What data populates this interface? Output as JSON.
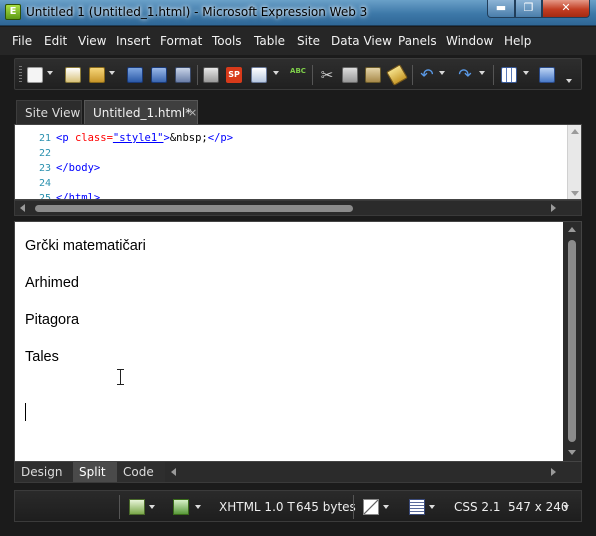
{
  "window": {
    "title": "Untitled 1 (Untitled_1.html) - Microsoft Expression Web 3",
    "app_icon_letter": "E",
    "min_glyph": "▬",
    "max_glyph": "❐",
    "close_glyph": "✕"
  },
  "menu": [
    "File",
    "Edit",
    "View",
    "Insert",
    "Format",
    "Tools",
    "Table",
    "Site",
    "Data View",
    "Panels",
    "Window",
    "Help"
  ],
  "toolbar": {
    "icons": [
      "new-page-icon",
      "open-icon",
      "open-folder-icon",
      "save-icon",
      "save-all-icon",
      "find-icon",
      "print-icon",
      "sharepoint-icon",
      "preview-in-browser-icon",
      "spelling-icon",
      "cut-icon",
      "copy-icon",
      "paste-icon",
      "format-painter-icon",
      "undo-icon",
      "redo-icon",
      "insert-table-icon",
      "insert-layer-icon"
    ],
    "sharepoint_label": "SP",
    "spelling_label": "ABC"
  },
  "tabs": {
    "site_view": "Site View",
    "document": "Untitled_1.html*",
    "close_glyph": "×"
  },
  "code": {
    "lines": [
      {
        "num": "21",
        "tag_open": "<p ",
        "attr": "class=",
        "value": "\"style1\"",
        "rest": ">",
        "entity": "&nbsp;",
        "tag_close": "</p>"
      },
      {
        "num": "22",
        "text": ""
      },
      {
        "num": "23",
        "text": "</body>"
      },
      {
        "num": "24",
        "text": ""
      },
      {
        "num": "25",
        "text": "</html>"
      }
    ]
  },
  "design": {
    "paragraphs": [
      "Grčki matematičari",
      "Arhimed",
      "Pitagora",
      "Tales"
    ]
  },
  "views": {
    "design": "Design",
    "split": "Split",
    "code": "Code",
    "active": "Split"
  },
  "status": {
    "doctype": "XHTML 1.0 T",
    "size": "645 bytes",
    "css": "CSS 2.1",
    "dimensions": "547 x 240"
  },
  "colors": {
    "chrome_dark": "#1b1b1b",
    "title_blue": "#3d78a8",
    "close_red": "#c23d22",
    "code_tag": "#0000ff",
    "code_attr": "#ff0000",
    "line_number": "#2b91af"
  }
}
